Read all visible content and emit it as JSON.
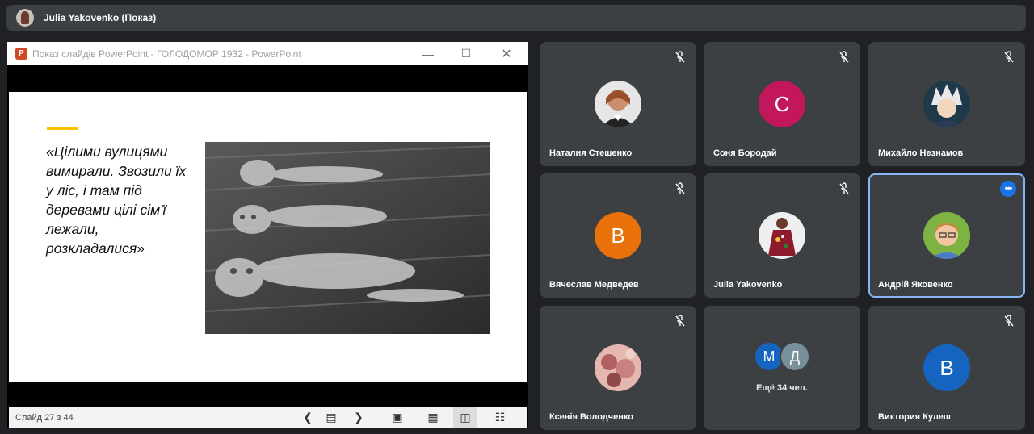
{
  "topbar": {
    "presenter_label": "Julia Yakovenko (Показ)"
  },
  "presentation": {
    "window_title": "Показ слайдів PowerPoint  -  ГОЛОДОМОР 1932  -  PowerPoint",
    "app_icon_letter": "P",
    "quote": "«Цілими вулицями вимирали. Звозили їх у ліс, і там під деревами цілі сім'ї лежали, розкладалися»",
    "slide_counter": "Слайд 27 з 44",
    "accent_color": "#ffc000"
  },
  "participants": [
    {
      "name": "Наталия Стешенко",
      "avatar_type": "photo",
      "muted": true
    },
    {
      "name": "Соня Бородай",
      "avatar_type": "letter",
      "letter": "С",
      "color": "#c2185b",
      "muted": true
    },
    {
      "name": "Михайло Незнамов",
      "avatar_type": "photo",
      "muted": true
    },
    {
      "name": "Вячеслав Медведев",
      "avatar_type": "letter",
      "letter": "В",
      "color": "#e8710a",
      "muted": true
    },
    {
      "name": "Julia Yakovenko",
      "avatar_type": "photo",
      "muted": true
    },
    {
      "name": "Андрій Яковенко",
      "avatar_type": "photo",
      "muted": false,
      "active": true
    },
    {
      "name": "Ксенія Володченко",
      "avatar_type": "photo",
      "muted": true
    },
    {
      "name": "Виктория Кулеш",
      "avatar_type": "letter",
      "letter": "В",
      "color": "#1565c0",
      "muted": true
    }
  ],
  "others": {
    "letters": [
      "М",
      "Д"
    ],
    "colors": [
      "#1565c0",
      "#78909c"
    ],
    "label": "Ещё 34 чел."
  }
}
